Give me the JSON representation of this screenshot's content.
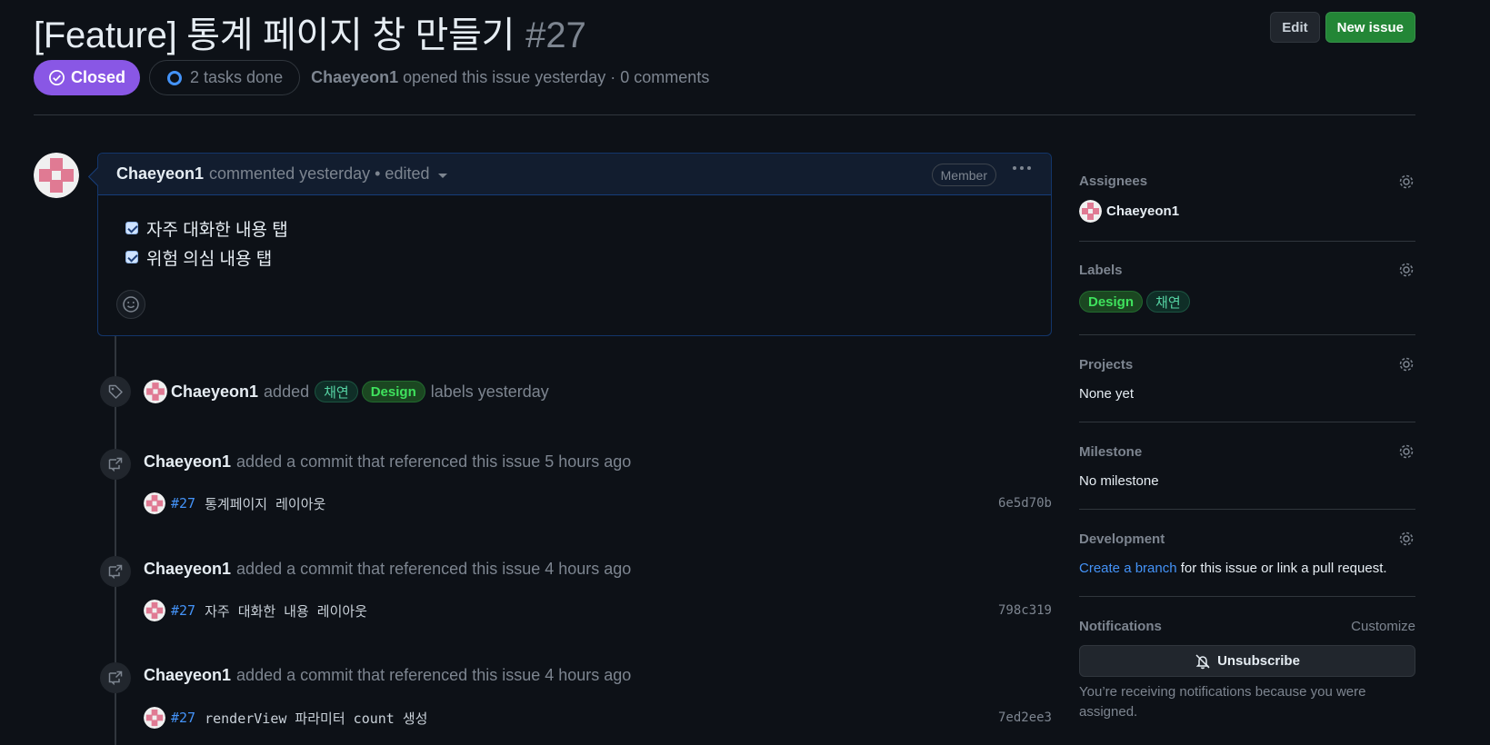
{
  "issue": {
    "title": "[Feature] 통계 페이지 창 만들기",
    "number": "#27",
    "state": "Closed",
    "tasks": "2 tasks done",
    "author": "Chaeyeon1",
    "meta": "opened this issue yesterday · 0 comments"
  },
  "header_actions": {
    "edit": "Edit",
    "new_issue": "New issue"
  },
  "comment": {
    "author": "Chaeyeon1",
    "meta": "commented yesterday • edited",
    "badge": "Member",
    "tasks": [
      {
        "text": "자주 대화한 내용 탭",
        "checked": true
      },
      {
        "text": "위험 의심 내용 탭",
        "checked": true
      }
    ]
  },
  "timeline": {
    "label_event": {
      "actor": "Chaeyeon1",
      "verb": "added",
      "labels": [
        "채연",
        "Design"
      ],
      "suffix": "labels yesterday"
    },
    "commit_events": [
      {
        "actor": "Chaeyeon1",
        "text": "added a commit that referenced this issue 5 hours ago",
        "ref": "#27",
        "message": "통계페이지 레이아웃",
        "sha": "6e5d70b"
      },
      {
        "actor": "Chaeyeon1",
        "text": "added a commit that referenced this issue 4 hours ago",
        "ref": "#27",
        "message": "자주 대화한 내용 레이아웃",
        "sha": "798c319"
      },
      {
        "actor": "Chaeyeon1",
        "text": "added a commit that referenced this issue 4 hours ago",
        "ref": "#27",
        "message": "renderView 파라미터 count 생성",
        "sha": "7ed2ee3"
      }
    ]
  },
  "sidebar": {
    "assignees": {
      "title": "Assignees",
      "value": "Chaeyeon1"
    },
    "labels": {
      "title": "Labels",
      "items": [
        "Design",
        "채연"
      ]
    },
    "projects": {
      "title": "Projects",
      "value": "None yet"
    },
    "milestone": {
      "title": "Milestone",
      "value": "No milestone"
    },
    "development": {
      "title": "Development",
      "link": "Create a branch",
      "text": "for this issue or link a pull request."
    },
    "notifications": {
      "title": "Notifications",
      "customize": "Customize",
      "button": "Unsubscribe",
      "note": "You’re receiving notifications because you were assigned."
    }
  },
  "colors": {
    "background": "#0d1117",
    "closed": "#8957e5",
    "primary_button": "#238636",
    "link": "#4493f8",
    "label_design": "#3fe25d",
    "label_chaeyeon": "#56d3a3"
  }
}
